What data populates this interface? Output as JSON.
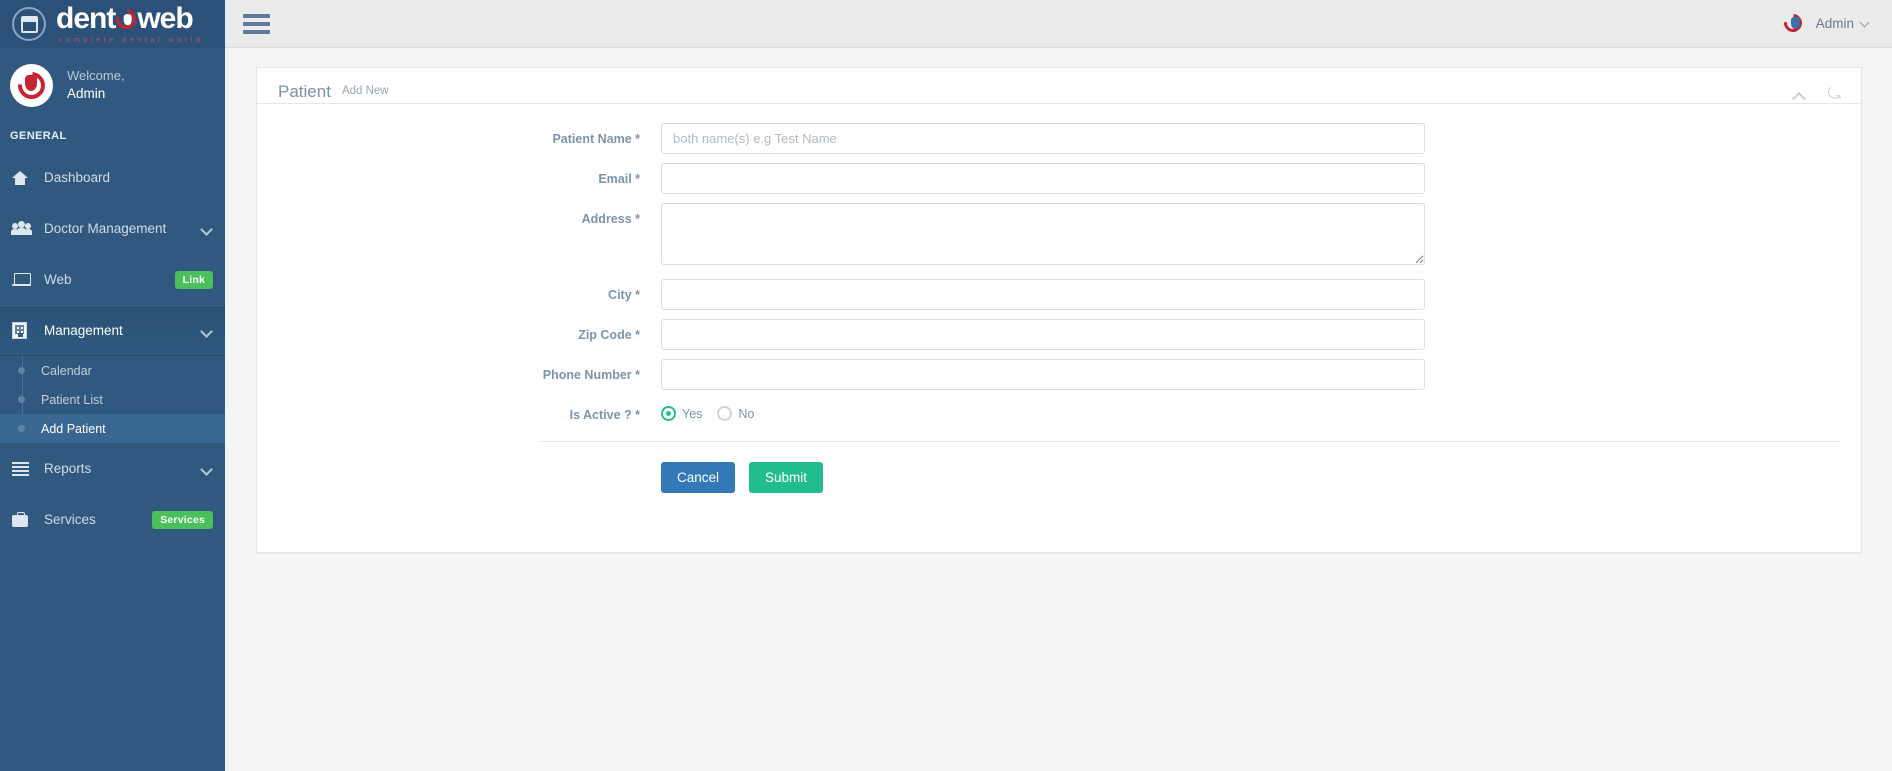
{
  "brand": {
    "name_part1": "dent",
    "name_part2": "web",
    "tagline": "complete dental world",
    "logo_icon": "calendar-tooth-icon",
    "accent_red": "#c62433",
    "sidebar_blue": "#31597f"
  },
  "sidebar": {
    "welcome_label": "Welcome,",
    "user_name": "Admin",
    "section_label": "GENERAL",
    "items": [
      {
        "label": "Dashboard",
        "icon": "home-icon",
        "has_chevron": false,
        "badge": null,
        "active": false
      },
      {
        "label": "Doctor Management",
        "icon": "users-icon",
        "has_chevron": true,
        "badge": null,
        "active": false
      },
      {
        "label": "Web",
        "icon": "laptop-icon",
        "has_chevron": false,
        "badge": "Link",
        "active": false
      },
      {
        "label": "Management",
        "icon": "building-icon",
        "has_chevron": true,
        "badge": null,
        "active": true
      }
    ],
    "submenu": [
      {
        "label": "Calendar",
        "active": false
      },
      {
        "label": "Patient List",
        "active": false
      },
      {
        "label": "Add Patient",
        "active": true
      }
    ],
    "items_after": [
      {
        "label": "Reports",
        "icon": "list-icon",
        "has_chevron": true,
        "badge": null,
        "active": false
      },
      {
        "label": "Services",
        "icon": "briefcase-icon",
        "has_chevron": false,
        "badge": "Services",
        "active": false
      }
    ],
    "badge_color": "#4cbf5d"
  },
  "topbar": {
    "menu_toggle_icon": "hamburger-icon",
    "logo_icon": "tooth-ring-icon",
    "admin_label": "Admin",
    "caret_icon": "chevron-down-icon"
  },
  "panel": {
    "title": "Patient",
    "subtitle": "Add New",
    "collapse_icon": "chevron-up-icon",
    "reply_icon": "reply-all-icon"
  },
  "form": {
    "fields": [
      {
        "label": "Patient Name *",
        "type": "text",
        "value": "",
        "placeholder": "both name(s) e.g Test Name",
        "name": "patient-name-input"
      },
      {
        "label": "Email *",
        "type": "text",
        "value": "",
        "placeholder": "",
        "name": "email-input"
      },
      {
        "label": "Address *",
        "type": "textarea",
        "value": "",
        "placeholder": "",
        "name": "address-input"
      },
      {
        "label": "City *",
        "type": "text",
        "value": "",
        "placeholder": "",
        "name": "city-input"
      },
      {
        "label": "Zip Code *",
        "type": "text",
        "value": "",
        "placeholder": "",
        "name": "zip-code-input"
      },
      {
        "label": "Phone Number *",
        "type": "text",
        "value": "",
        "placeholder": "",
        "name": "phone-number-input"
      }
    ],
    "is_active": {
      "label": "Is Active ? *",
      "options": [
        {
          "label": "Yes",
          "selected": true
        },
        {
          "label": "No",
          "selected": false
        }
      ],
      "selected_color": "#1fbf8f"
    },
    "cancel_label": "Cancel",
    "submit_label": "Submit",
    "cancel_color": "#3479b7",
    "submit_color": "#22bd8e"
  }
}
